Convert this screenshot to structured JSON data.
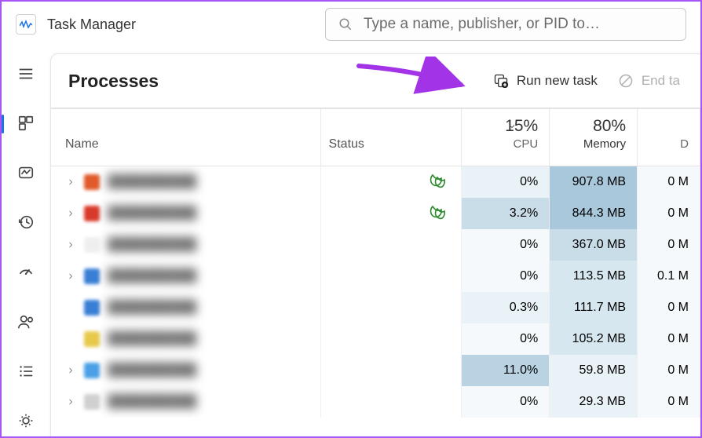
{
  "app": {
    "title": "Task Manager"
  },
  "search": {
    "placeholder": "Type a name, publisher, or PID to…"
  },
  "header": {
    "title": "Processes",
    "run_label": "Run new task",
    "end_label": "End ta"
  },
  "columns": {
    "name": "Name",
    "status": "Status",
    "cpu_pct": "15%",
    "cpu_label": "CPU",
    "mem_pct": "80%",
    "mem_label": "Memory",
    "disk_label": "D"
  },
  "rows": [
    {
      "expandable": true,
      "icon_color": "#e05a2a",
      "leaf": true,
      "cpu": "0%",
      "cpu_h": 1,
      "mem": "907.8 MB",
      "mem_h": 5,
      "disk": "0 M"
    },
    {
      "expandable": true,
      "icon_color": "#d93a2a",
      "leaf": true,
      "cpu": "3.2%",
      "cpu_h": 3,
      "mem": "844.3 MB",
      "mem_h": 5,
      "disk": "0 M"
    },
    {
      "expandable": true,
      "icon_color": "#efefef",
      "leaf": false,
      "cpu": "0%",
      "cpu_h": 0,
      "mem": "367.0 MB",
      "mem_h": 3,
      "disk": "0 M"
    },
    {
      "expandable": true,
      "icon_color": "#3a7fd6",
      "leaf": false,
      "cpu": "0%",
      "cpu_h": 0,
      "mem": "113.5 MB",
      "mem_h": 2,
      "disk": "0.1 M"
    },
    {
      "expandable": false,
      "icon_color": "#3a7fd6",
      "leaf": false,
      "cpu": "0.3%",
      "cpu_h": 1,
      "mem": "111.7 MB",
      "mem_h": 2,
      "disk": "0 M"
    },
    {
      "expandable": false,
      "icon_color": "#e6c94a",
      "leaf": false,
      "cpu": "0%",
      "cpu_h": 0,
      "mem": "105.2 MB",
      "mem_h": 2,
      "disk": "0 M"
    },
    {
      "expandable": true,
      "icon_color": "#4aa0e6",
      "leaf": false,
      "cpu": "11.0%",
      "cpu_h": 4,
      "mem": "59.8 MB",
      "mem_h": 1,
      "disk": "0 M"
    },
    {
      "expandable": true,
      "icon_color": "#d0d0d0",
      "leaf": false,
      "cpu": "0%",
      "cpu_h": 0,
      "mem": "29.3 MB",
      "mem_h": 1,
      "disk": "0 M"
    }
  ]
}
